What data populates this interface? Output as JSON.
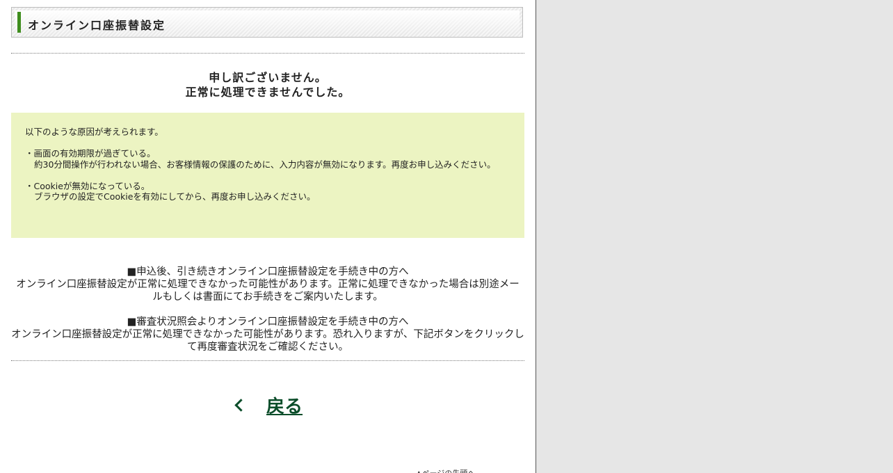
{
  "header": {
    "title": "オンライン口座振替設定"
  },
  "apology": {
    "line1": "申し訳ございません。",
    "line2": "正常に処理できませんでした。"
  },
  "reasons": {
    "intro": "以下のような原因が考えられます。",
    "items": [
      {
        "title": "・画面の有効期限が過ぎている。",
        "detail": "約30分間操作が行われない場合、お客様情報の保護のために、入力内容が無効になります。再度お申し込みください。"
      },
      {
        "title": "・Cookieが無効になっている。",
        "detail": "ブラウザの設定でCookieを有効にしてから、再度お申し込みください。"
      }
    ]
  },
  "notices": [
    {
      "heading": "■申込後、引き続きオンライン口座振替設定を手続き中の方へ",
      "body": "オンライン口座振替設定が正常に処理できなかった可能性があります。正常に処理できなかった場合は別途メールもしくは書面にてお手続きをご案内いたします。"
    },
    {
      "heading": "■審査状況照会よりオンライン口座振替設定を手続き中の方へ",
      "body": "オンライン口座振替設定が正常に処理できなかった可能性があります。恐れ入りますが、下記ボタンをクリックして再度審査状況をご確認ください。"
    }
  ],
  "back_button": {
    "label": "戻る"
  },
  "page_top": {
    "label": "▲ページの先頭へ"
  },
  "colors": {
    "accent_green": "#3f8d1e",
    "link_green": "#0b4d2a",
    "reason_bg": "#ecf4c2",
    "side_bg": "#e6e6e6"
  }
}
